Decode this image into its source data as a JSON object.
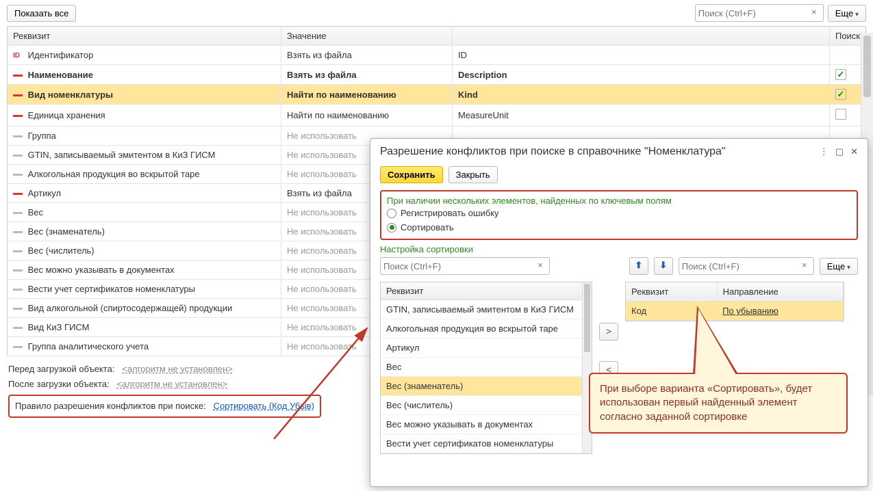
{
  "toolbar": {
    "show_all": "Показать все",
    "search_placeholder": "Поиск (Ctrl+F)",
    "more": "Еще"
  },
  "table": {
    "headers": {
      "c1": "Реквизит",
      "c2": "Значение",
      "c3": "",
      "c4": "Поиск"
    },
    "rows": [
      {
        "mark": "id",
        "name": "Идентификатор",
        "value": "Взять из файла",
        "col3": "ID",
        "chk": null,
        "bold": false
      },
      {
        "mark": "red",
        "name": "Наименование",
        "value": "Взять из файла",
        "col3": "Description",
        "chk": true,
        "bold": true
      },
      {
        "mark": "red",
        "name": "Вид номенклатуры",
        "value": "Найти по наименованию",
        "col3": "Kind",
        "chk": true,
        "bold": true,
        "sel": true
      },
      {
        "mark": "red",
        "name": "Единица хранения",
        "value": "Найти по наименованию",
        "col3": "MeasureUnit",
        "chk": false,
        "bold": false
      },
      {
        "mark": "grey",
        "name": "Группа",
        "value": "Не использовать",
        "fade": true
      },
      {
        "mark": "grey",
        "name": "GTIN, записываемый эмитентом в КиЗ ГИСМ",
        "value": "Не использовать",
        "fade": true
      },
      {
        "mark": "grey",
        "name": "Алкогольная продукция во вскрытой таре",
        "value": "Не использовать",
        "fade": true
      },
      {
        "mark": "red",
        "name": "Артикул",
        "value": "Взять из файла",
        "bold": false
      },
      {
        "mark": "grey",
        "name": "Вес",
        "value": "Не использовать",
        "fade": true
      },
      {
        "mark": "grey",
        "name": "Вес (знаменатель)",
        "value": "Не использовать",
        "fade": true
      },
      {
        "mark": "grey",
        "name": "Вес (числитель)",
        "value": "Не использовать",
        "fade": true
      },
      {
        "mark": "grey",
        "name": "Вес можно указывать в документах",
        "value": "Не использовать",
        "fade": true
      },
      {
        "mark": "grey",
        "name": "Вести учет сертификатов номенклатуры",
        "value": "Не использовать",
        "fade": true
      },
      {
        "mark": "grey",
        "name": "Вид алкогольной (спиртосодержащей) продукции",
        "value": "Не использовать",
        "fade": true
      },
      {
        "mark": "grey",
        "name": "Вид КиЗ ГИСМ",
        "value": "Не использовать",
        "fade": true
      },
      {
        "mark": "grey",
        "name": "Группа аналитического учета",
        "value": "Не использовать",
        "fade": true
      }
    ]
  },
  "footer": {
    "before_label": "Перед загрузкой объекта:",
    "before_link": "<алгоритм не установлен>",
    "after_label": "После загрузки объекта:",
    "after_link": "<алгоритм не установлен>",
    "rule_label": "Правило разрешения конфликтов при поиске:",
    "rule_link": "Сортировать (Код Убыв)"
  },
  "dialog": {
    "title": "Разрешение конфликтов при поиске в справочнике \"Номенклатура\"",
    "save": "Сохранить",
    "close": "Закрыть",
    "section_label": "При наличии нескольких элементов, найденных по ключевым полям",
    "radio1": "Регистрировать ошибку",
    "radio2": "Сортировать",
    "sort_label": "Настройка сортировки",
    "search_placeholder": "Поиск (Ctrl+F)",
    "more": "Еще",
    "list_header": "Реквизит",
    "list_items": [
      "GTIN, записываемый эмитентом в КиЗ ГИСМ",
      "Алкогольная продукция во вскрытой таре",
      "Артикул",
      "Вес",
      "Вес (знаменатель)",
      "Вес (числитель)",
      "Вес можно указывать в документах",
      "Вести учет сертификатов номенклатуры"
    ],
    "list_sel_index": 4,
    "sort_headers": {
      "rekv": "Реквизит",
      "dir": "Направление"
    },
    "sort_row": {
      "rekv": "Код",
      "dir": "По убыванию"
    }
  },
  "callout": "При выборе варианта «Сортировать», будет использован первый найденный элемент согласно заданной сортировке"
}
